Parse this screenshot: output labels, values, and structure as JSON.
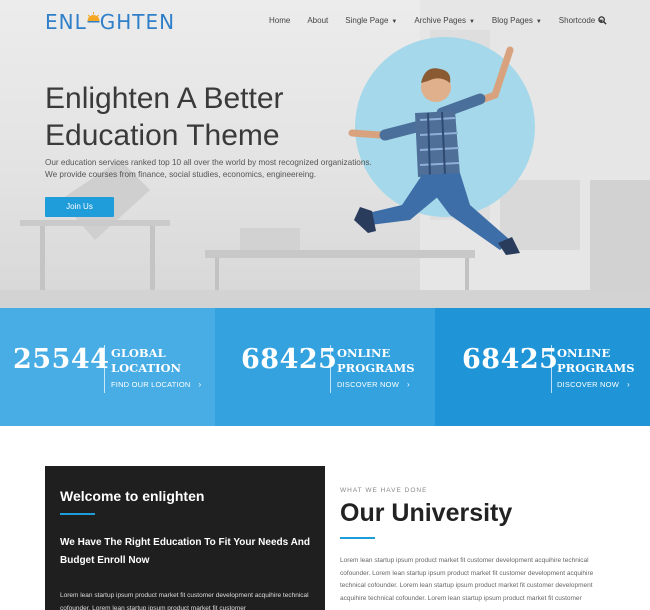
{
  "brand": {
    "logo_left": "ENL",
    "logo_right": "GHTEN"
  },
  "nav": {
    "items": [
      {
        "label": "Home"
      },
      {
        "label": "About"
      },
      {
        "label": "Single Page",
        "dropdown": true
      },
      {
        "label": "Archive Pages",
        "dropdown": true
      },
      {
        "label": "Blog Pages",
        "dropdown": true
      },
      {
        "label": "Shortcode",
        "dropdown": true
      }
    ],
    "search_icon": "search-icon"
  },
  "hero": {
    "title_line1": "Enlighten A Better",
    "title_line2": "Education Theme",
    "desc_line1": "Our education services ranked top 10 all over the world by most recognized organizations.",
    "desc_line2": "We provide courses from finance, social studies, economics, engineereing.",
    "button": "Join Us"
  },
  "stats": [
    {
      "number": "25544",
      "title_line1": "GLOBAL",
      "title_line2": "LOCATION",
      "link": "FIND OUR LOCATION"
    },
    {
      "number": "68425",
      "title_line1": "ONLINE",
      "title_line2": "PROGRAMS",
      "link": "DISCOVER NOW"
    },
    {
      "number": "68425",
      "title_line1": "ONLINE",
      "title_line2": "PROGRAMS",
      "link": "DISCOVER NOW"
    }
  ],
  "welcome": {
    "title": "Welcome to enlighten",
    "subtitle": "We Have The Right Education To Fit Your Needs And Budget Enroll Now",
    "body": "Lorem lean startup ipsum product market fit customer development acquihire technical cofounder. Lorem lean startup ipsum product market fit customer"
  },
  "university": {
    "eyebrow": "WHAT WE HAVE DONE",
    "title": "Our University",
    "body": "Lorem lean startup ipsum product market fit customer development acquihire technical cofounder. Lorem lean startup ipsum product market fit customer development acquihire technical cofounder. Lorem lean startup ipsum product market fit customer development acquihire technical cofounder. Lorem lean startup ipsum product market fit customer"
  },
  "colors": {
    "accent": "#1f9cda",
    "circle": "#a4d8ea",
    "dark": "#1f1f1f",
    "stat1": "#49ade5",
    "stat2": "#33a2df",
    "stat3": "#1f95d8"
  }
}
